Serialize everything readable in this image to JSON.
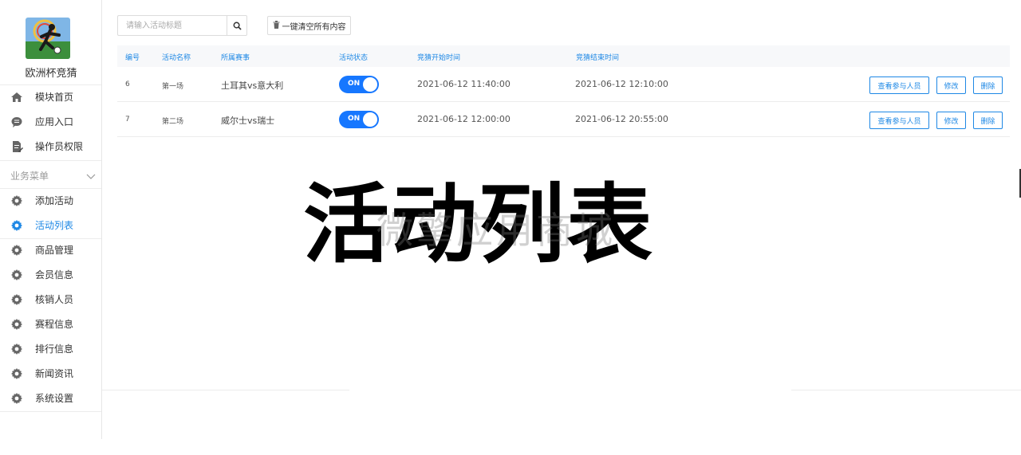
{
  "sidebar": {
    "brand": "欧洲杯竞猜",
    "top_items": [
      {
        "label": "模块首页",
        "icon": "home-icon"
      },
      {
        "label": "应用入口",
        "icon": "chat-icon"
      },
      {
        "label": "操作员权限",
        "icon": "edit-doc-icon"
      }
    ],
    "section_title": "业务菜单",
    "business_items": [
      {
        "label": "添加活动",
        "icon": "gear-icon"
      },
      {
        "label": "活动列表",
        "icon": "gear-icon",
        "active": true
      },
      {
        "label": "商品管理",
        "icon": "gear-icon"
      },
      {
        "label": "会员信息",
        "icon": "gear-icon"
      },
      {
        "label": "核销人员",
        "icon": "gear-icon"
      },
      {
        "label": "赛程信息",
        "icon": "gear-icon"
      },
      {
        "label": "排行信息",
        "icon": "gear-icon"
      },
      {
        "label": "新闻资讯",
        "icon": "gear-icon"
      },
      {
        "label": "系统设置",
        "icon": "gear-icon"
      }
    ]
  },
  "toolbar": {
    "search_placeholder": "请输入活动标题",
    "search_value": "",
    "clear_label": "一键清空所有内容"
  },
  "table": {
    "headers": [
      "编号",
      "活动名称",
      "所属赛事",
      "活动状态",
      "竞猜开始时间",
      "竞猜结束时间"
    ],
    "rows": [
      {
        "id": "6",
        "name": "第一场",
        "match": "土耳其vs意大利",
        "status": "ON",
        "start": "2021-06-12 11:40:00",
        "end": "2021-06-12 12:10:00"
      },
      {
        "id": "7",
        "name": "第二场",
        "match": "威尔士vs瑞士",
        "status": "ON",
        "start": "2021-06-12 12:00:00",
        "end": "2021-06-12 20:55:00"
      }
    ],
    "actions": {
      "view": "查看参与人员",
      "edit": "修改",
      "delete": "删除"
    }
  },
  "overlay": {
    "title": "活动列表",
    "watermark": "微擎应用商城"
  },
  "colors": {
    "accent": "#1e88e5",
    "switch_on": "#1677ff"
  }
}
